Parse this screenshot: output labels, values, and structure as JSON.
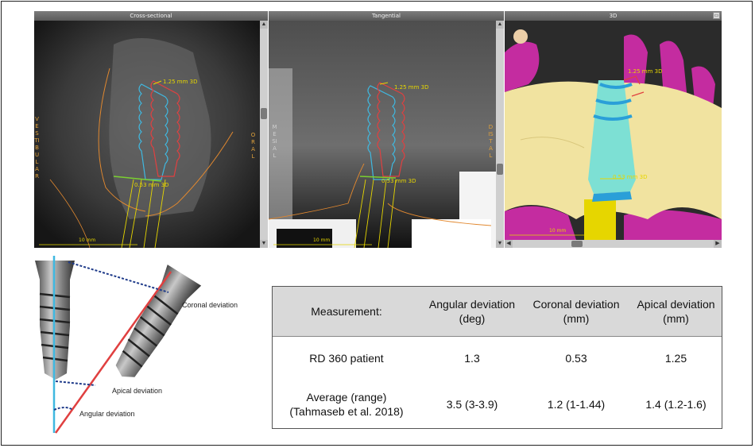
{
  "panels": [
    {
      "title": "Cross-sectional",
      "measure_top": "1.25 mm 3D",
      "measure_bottom": "0.53 mm 3D",
      "side_left": "VESTIBULAR",
      "side_right": "ORAL",
      "scale": "10 mm"
    },
    {
      "title": "Tangential",
      "measure_top": "1.25 mm 3D",
      "measure_bottom": "0.53 mm 3D",
      "side_left": "MESIAL",
      "side_right": "DISTAL",
      "scale": "10 mm"
    },
    {
      "title": "3D",
      "measure_top": "1.25 mm 3D",
      "measure_bottom": "0.53 mm 3D",
      "scale": "10 mm"
    }
  ],
  "illustration": {
    "coronal": "Coronal deviation",
    "apical": "Apical deviation",
    "angular": "Angular deviation"
  },
  "table": {
    "headers": [
      "Measurement:",
      "Angular deviation\n(deg)",
      "Coronal deviation\n(mm)",
      "Apical deviation\n(mm)"
    ],
    "rows": [
      {
        "label": "RD 360 patient",
        "angular": "1.3",
        "coronal": "0.53",
        "apical": "1.25"
      },
      {
        "label": "Average (range)\n(Tahmaseb et al. 2018)",
        "angular": "3.5 (3-3.9)",
        "coronal": "1.2 (1-1.44)",
        "apical": "1.4 (1.2-1.6)"
      }
    ]
  },
  "colors": {
    "implant_planned": "#3fb8e0",
    "implant_actual": "#e04040",
    "bone_3d": "#f1e3a0",
    "soft_3d": "#c42ca0",
    "measure": "#e6d600"
  }
}
